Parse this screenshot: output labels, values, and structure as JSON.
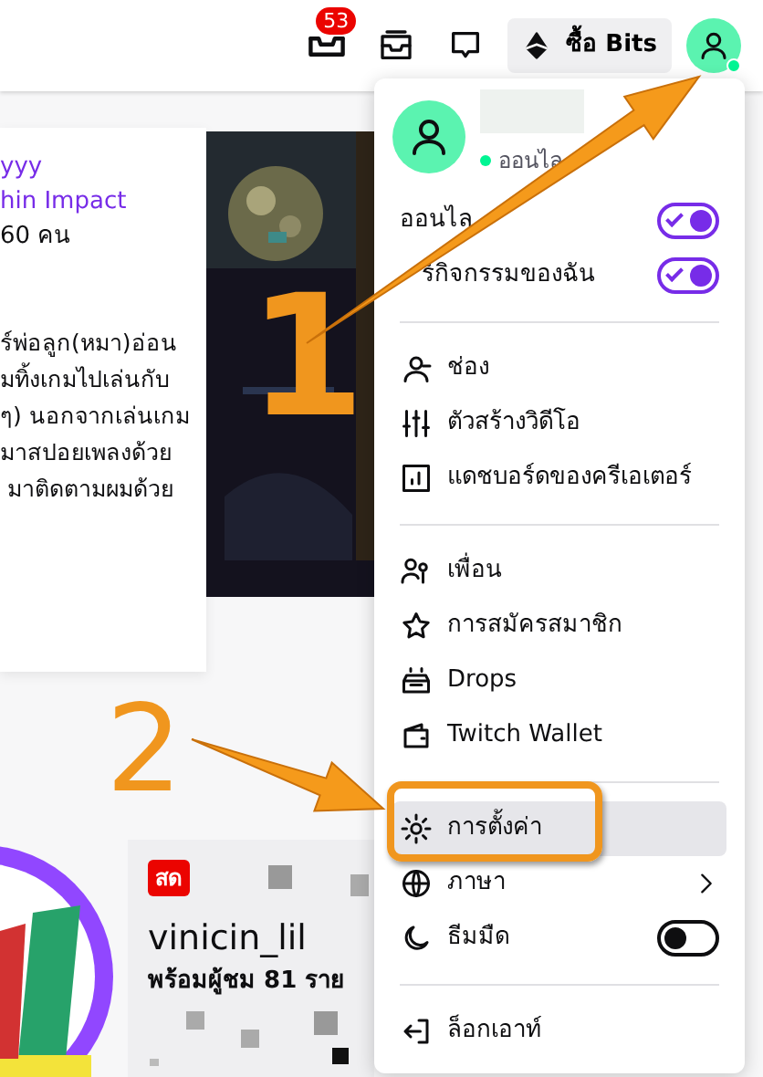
{
  "top_bar": {
    "notification_count": "53",
    "bits_button": "ซื้อ Bits",
    "avatar_online": true
  },
  "stream_card": {
    "title": "yyy",
    "game": "hin Impact",
    "viewers": "60 คน",
    "description": [
      "ร์พ่อลูก(หมา)อ่อน",
      "มทิ้งเกมไปเล่นกับ",
      "ๆ) นอกจากเล่นเกม",
      "มาสปอยเพลงด้วย",
      " มาติดตามผมด้วย"
    ]
  },
  "live_card": {
    "badge": "สด",
    "channel": "vinicin_lil",
    "viewers": "พร้อมผู้ชม 81 ราย"
  },
  "profile_menu": {
    "status": "ออนไล",
    "toggles": [
      {
        "label": "ออนไล",
        "on": true
      },
      {
        "label": "ร์กิจกรรมของฉัน",
        "on": true
      }
    ],
    "sections": [
      [
        {
          "label": "ช่อง",
          "kind": "link",
          "selected": false
        },
        {
          "label": "ตัวสร้างวิดีโอ",
          "kind": "link",
          "selected": false
        },
        {
          "label": "แดชบอร์ดของครีเอเตอร์",
          "kind": "link",
          "selected": false
        }
      ],
      [
        {
          "label": "เพื่อน",
          "kind": "link",
          "selected": false
        },
        {
          "label": "การสมัครสมาชิก",
          "kind": "link",
          "selected": false
        },
        {
          "label": "Drops",
          "kind": "link",
          "selected": false
        },
        {
          "label": "Twitch Wallet",
          "kind": "link",
          "selected": false
        }
      ],
      [
        {
          "label": "การตั้งค่า",
          "kind": "link",
          "selected": true
        },
        {
          "label": "ภาษา",
          "kind": "submenu",
          "selected": false
        },
        {
          "label": "ธีมมืด",
          "kind": "toggle",
          "on": false,
          "selected": false
        }
      ],
      [
        {
          "label": "ล็อกเอาท์",
          "kind": "link",
          "selected": false
        }
      ]
    ]
  },
  "annotations": [
    {
      "label": "1"
    },
    {
      "label": "2"
    }
  ]
}
